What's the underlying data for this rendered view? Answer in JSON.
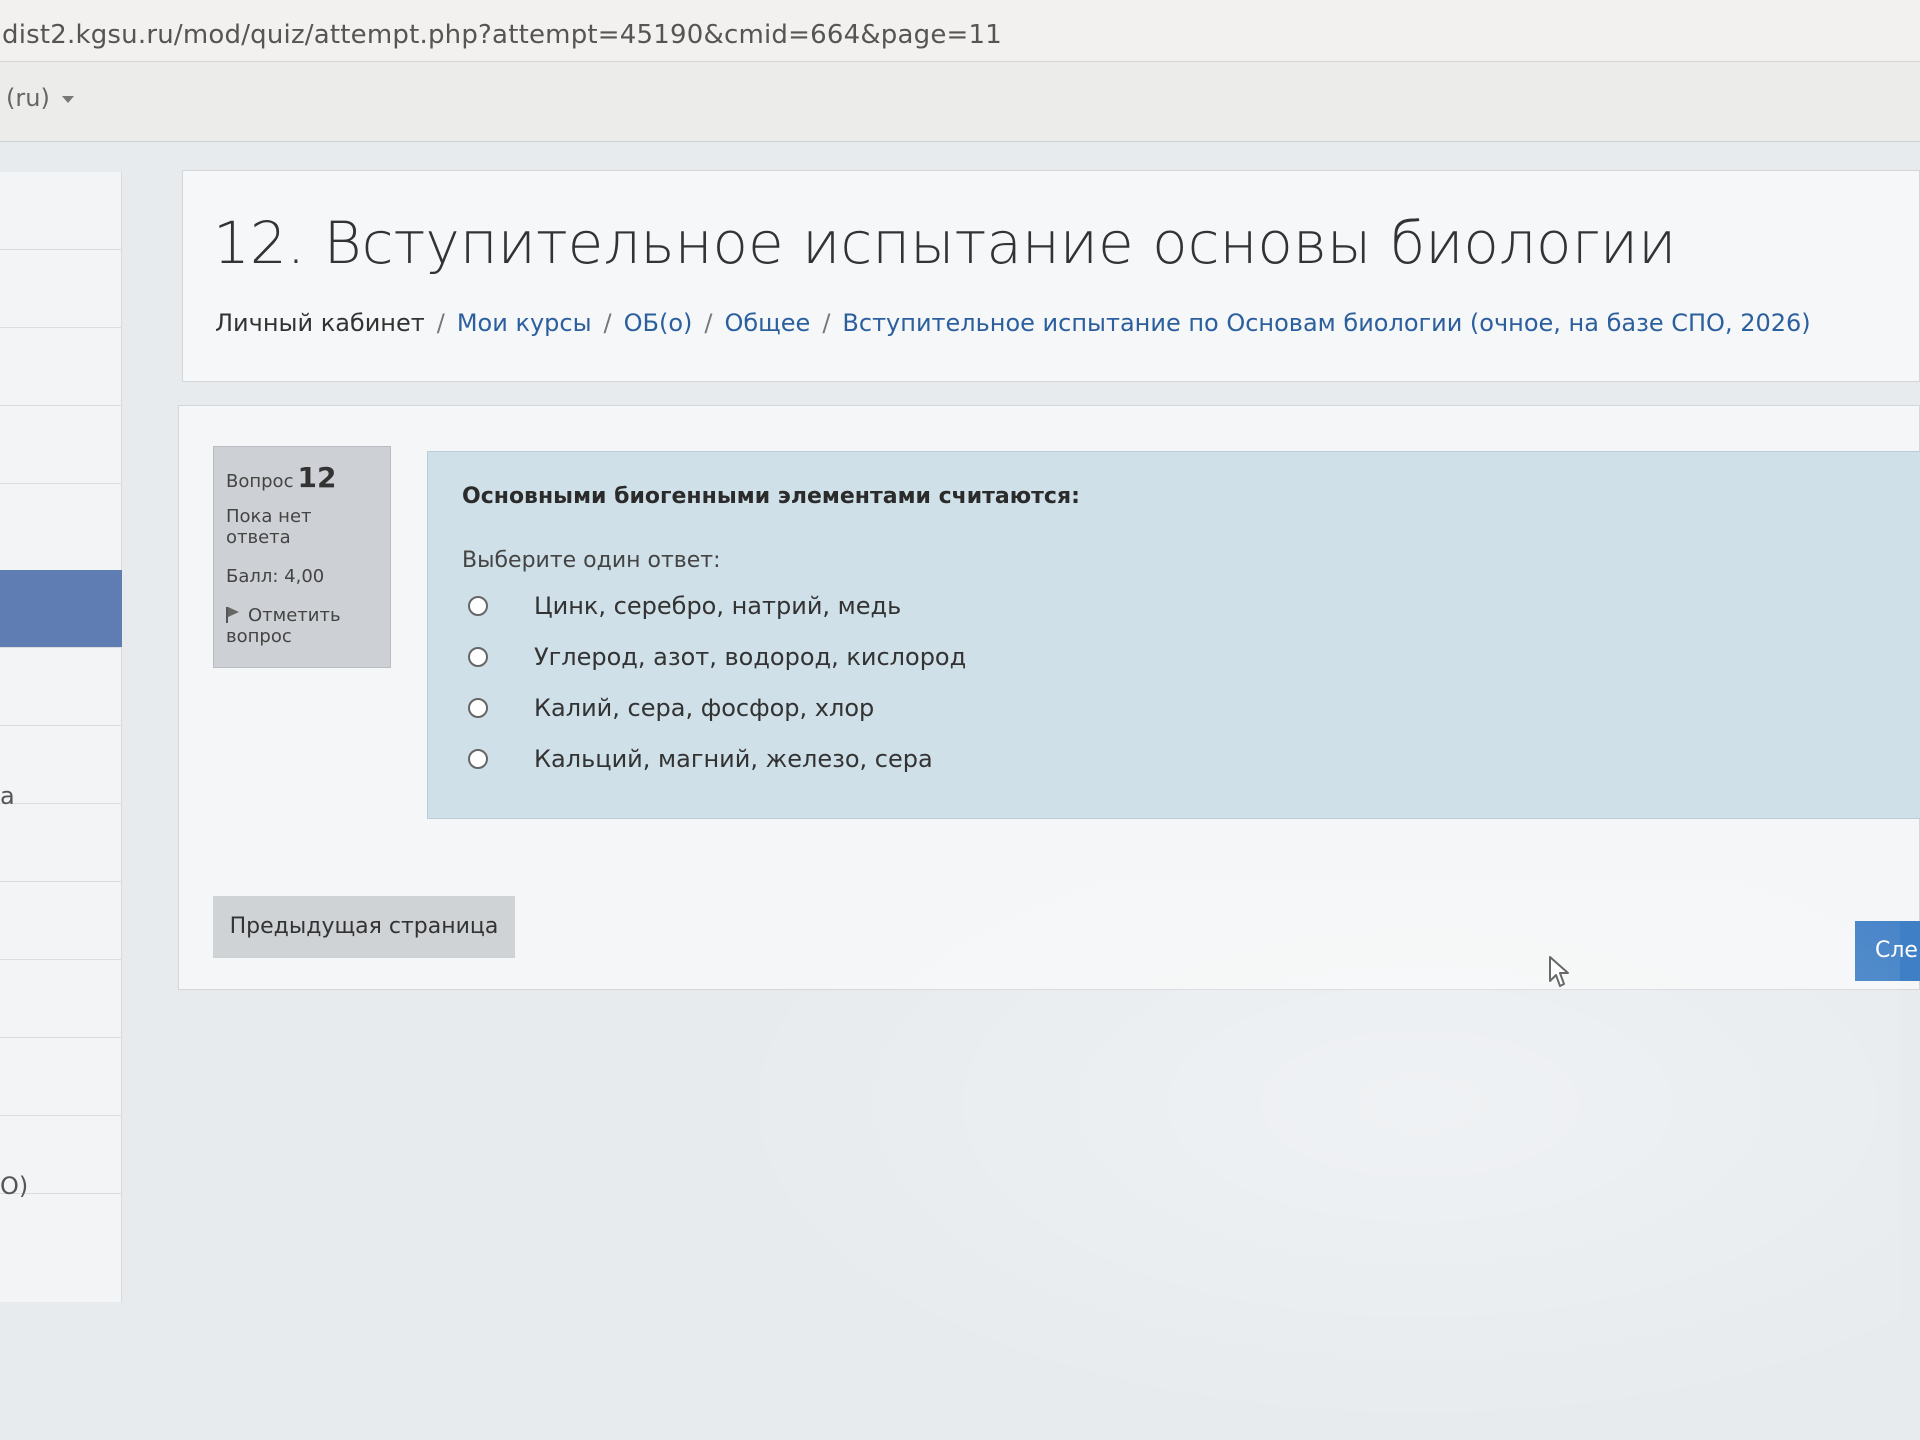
{
  "browser": {
    "url": "dist2.kgsu.ru/mod/quiz/attempt.php?attempt=45190&cmid=664&page=11"
  },
  "topnav": {
    "language": "(ru)"
  },
  "drawer": {
    "partial_texts": [
      "а",
      "O)"
    ]
  },
  "header": {
    "title": "12. Вступительное испытание основы биологии",
    "breadcrumb": [
      "Личный кабинет",
      "Мои курсы",
      "ОБ(о)",
      "Общее",
      "Вступительное испытание по Основам биологии (очное, на базе СПО, 2026)"
    ]
  },
  "question_info": {
    "label": "Вопрос",
    "number": "12",
    "state": "Пока нет ответа",
    "score": "Балл: 4,00",
    "flag_label": "Отметить вопрос"
  },
  "question": {
    "text": "Основными биогенными элементами считаются:",
    "prompt": "Выберите один ответ:",
    "answers": [
      "Цинк, серебро, натрий, медь",
      "Углерод, азот, водород, кислород",
      "Калий, сера, фосфор, хлор",
      "Кальций, магний, железо, сера"
    ]
  },
  "navigation": {
    "prev_label": "Предыдущая страница",
    "next_label": "Сле"
  }
}
